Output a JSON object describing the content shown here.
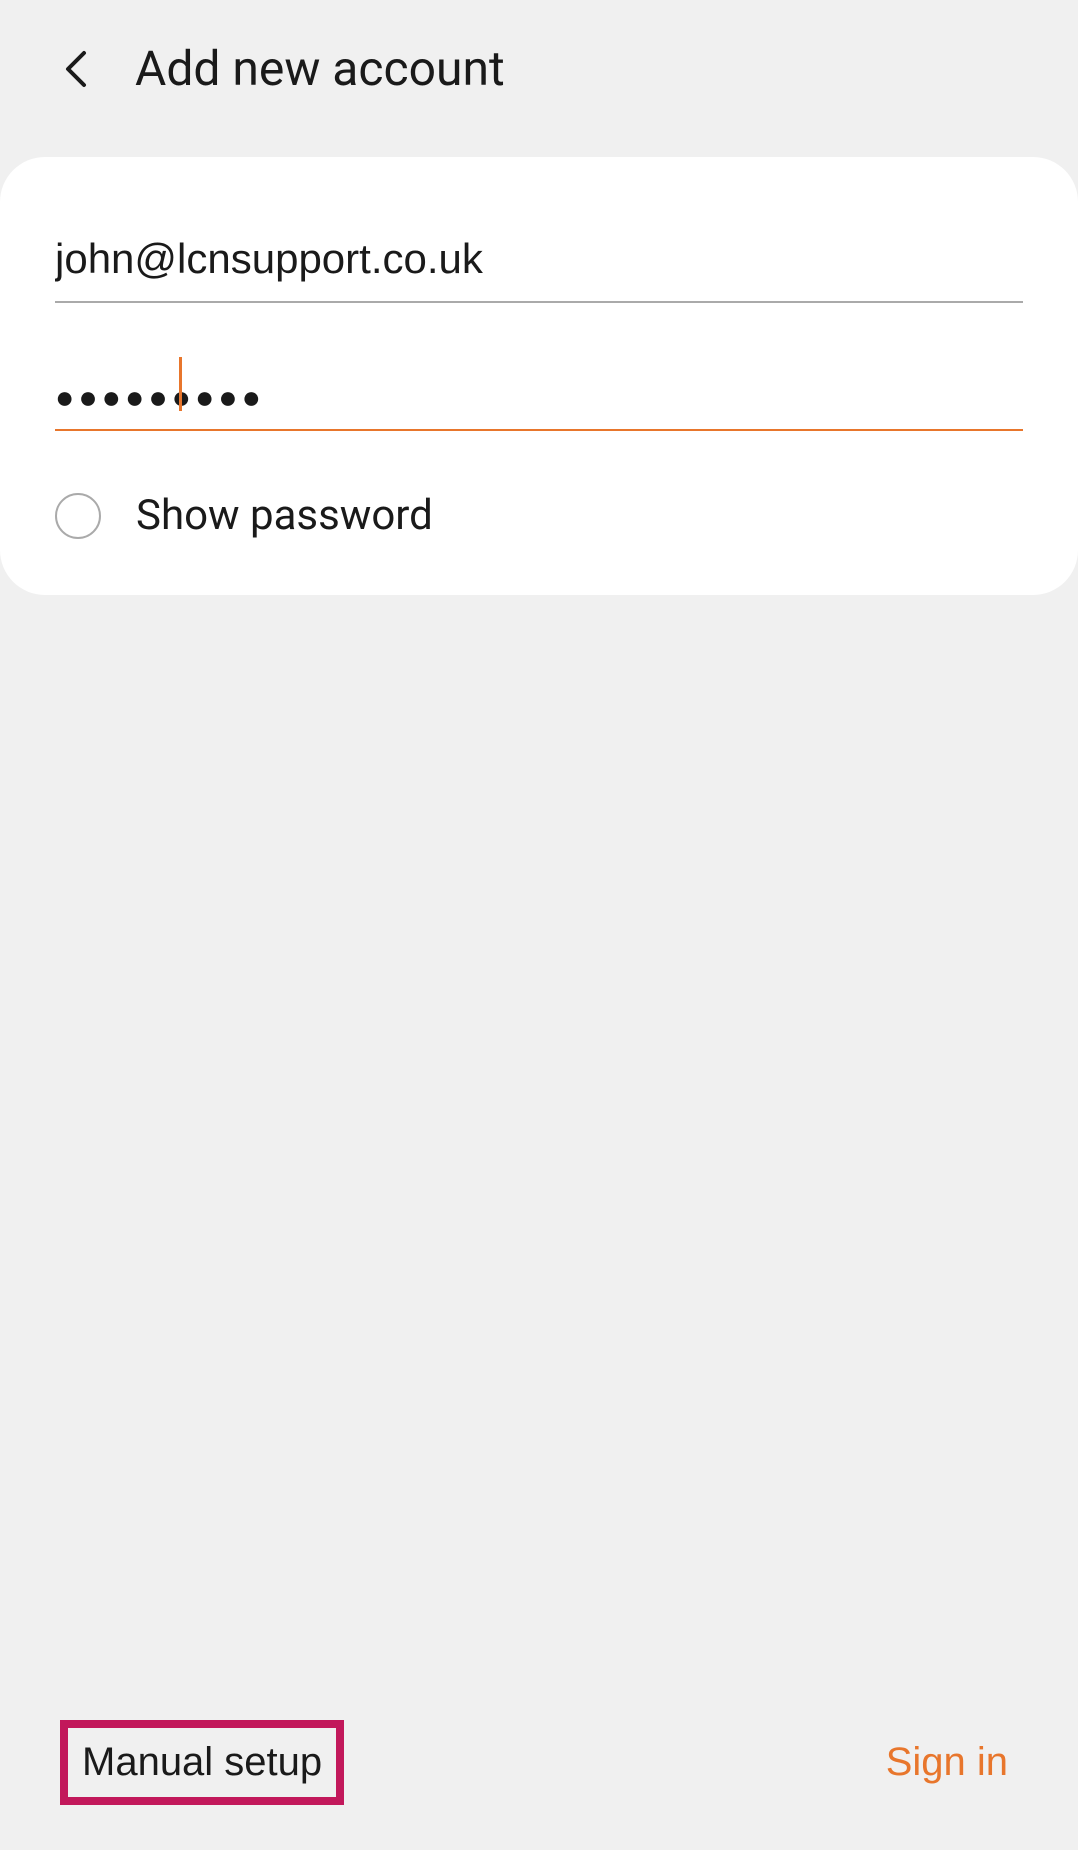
{
  "header": {
    "title": "Add new account"
  },
  "form": {
    "email_value": "john@lcnsupport.co.uk",
    "password_mask": "●●●●●●●●●",
    "show_password_label": "Show password"
  },
  "footer": {
    "manual_setup_label": "Manual setup",
    "signin_label": "Sign in"
  },
  "colors": {
    "accent": "#e8762c",
    "highlight": "#c2185b"
  }
}
